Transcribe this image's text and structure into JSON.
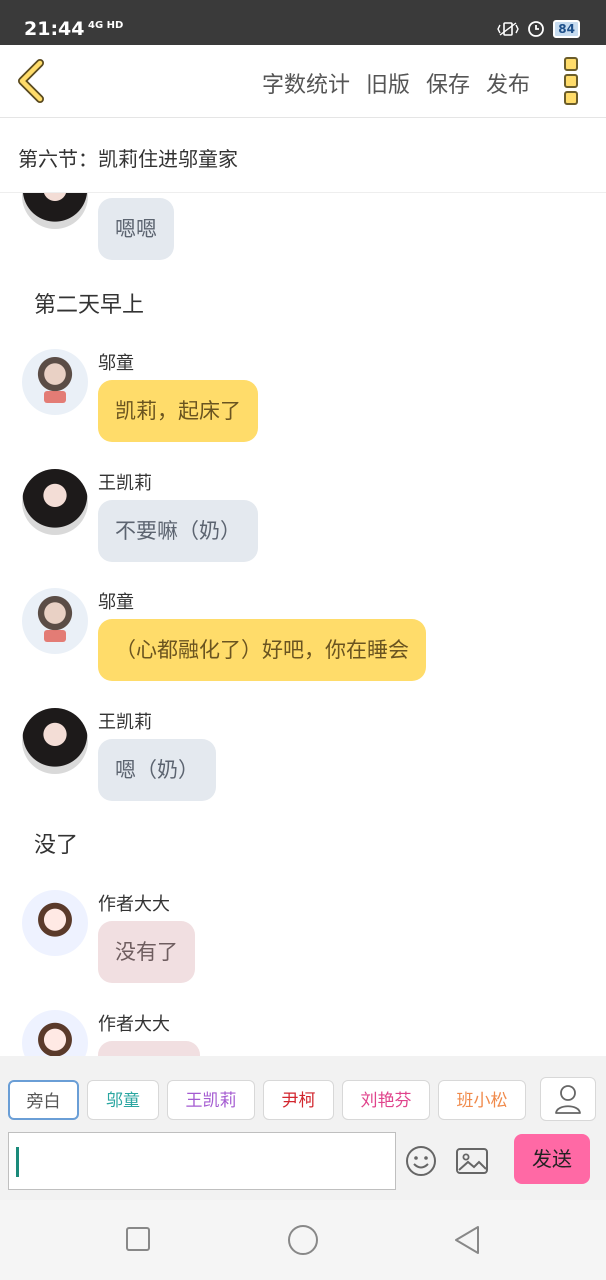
{
  "status_bar": {
    "time": "21:44",
    "network": "4G HD",
    "battery": "84"
  },
  "top_bar": {
    "actions": [
      "字数统计",
      "旧版",
      "保存",
      "发布"
    ]
  },
  "chapter": {
    "title": "第六节：凯莉住进邬童家"
  },
  "chat": [
    {
      "type": "message",
      "avatar": "av-kaili",
      "sender": "",
      "text": "嗯嗯",
      "style": "b-grey"
    },
    {
      "type": "narration",
      "text": "第二天早上"
    },
    {
      "type": "message",
      "avatar": "av-wutong",
      "sender": "邬童",
      "text": "凯莉，起床了",
      "style": "b-yellow"
    },
    {
      "type": "message",
      "avatar": "av-kaili",
      "sender": "王凯莉",
      "text": "不要嘛（奶）",
      "style": "b-grey"
    },
    {
      "type": "message",
      "avatar": "av-wutong",
      "sender": "邬童",
      "text": "（心都融化了）好吧，你在睡会",
      "style": "b-yellow"
    },
    {
      "type": "message",
      "avatar": "av-kaili",
      "sender": "王凯莉",
      "text": "嗯（奶）",
      "style": "b-grey"
    },
    {
      "type": "narration",
      "text": "没了"
    },
    {
      "type": "message",
      "avatar": "av-author",
      "sender": "作者大大",
      "text": "没有了",
      "style": "b-pink"
    },
    {
      "type": "message",
      "avatar": "av-author",
      "sender": "作者大大",
      "text": "",
      "style": "b-pink"
    }
  ],
  "characters": [
    {
      "label": "旁白",
      "color": "#555555",
      "selected": true
    },
    {
      "label": "邬童",
      "color": "#2aa6a1",
      "selected": false
    },
    {
      "label": "王凯莉",
      "color": "#a45bd1",
      "selected": false
    },
    {
      "label": "尹柯",
      "color": "#d2262e",
      "selected": false
    },
    {
      "label": "刘艳芬",
      "color": "#e0448c",
      "selected": false
    },
    {
      "label": "班小松",
      "color": "#f08a4b",
      "selected": false
    }
  ],
  "input": {
    "value": "",
    "send_label": "发送"
  },
  "colors": {
    "accent_yellow": "#ffdc6a",
    "send_pink": "#ff69a5",
    "selected_chip_border": "#6a9ed6"
  }
}
